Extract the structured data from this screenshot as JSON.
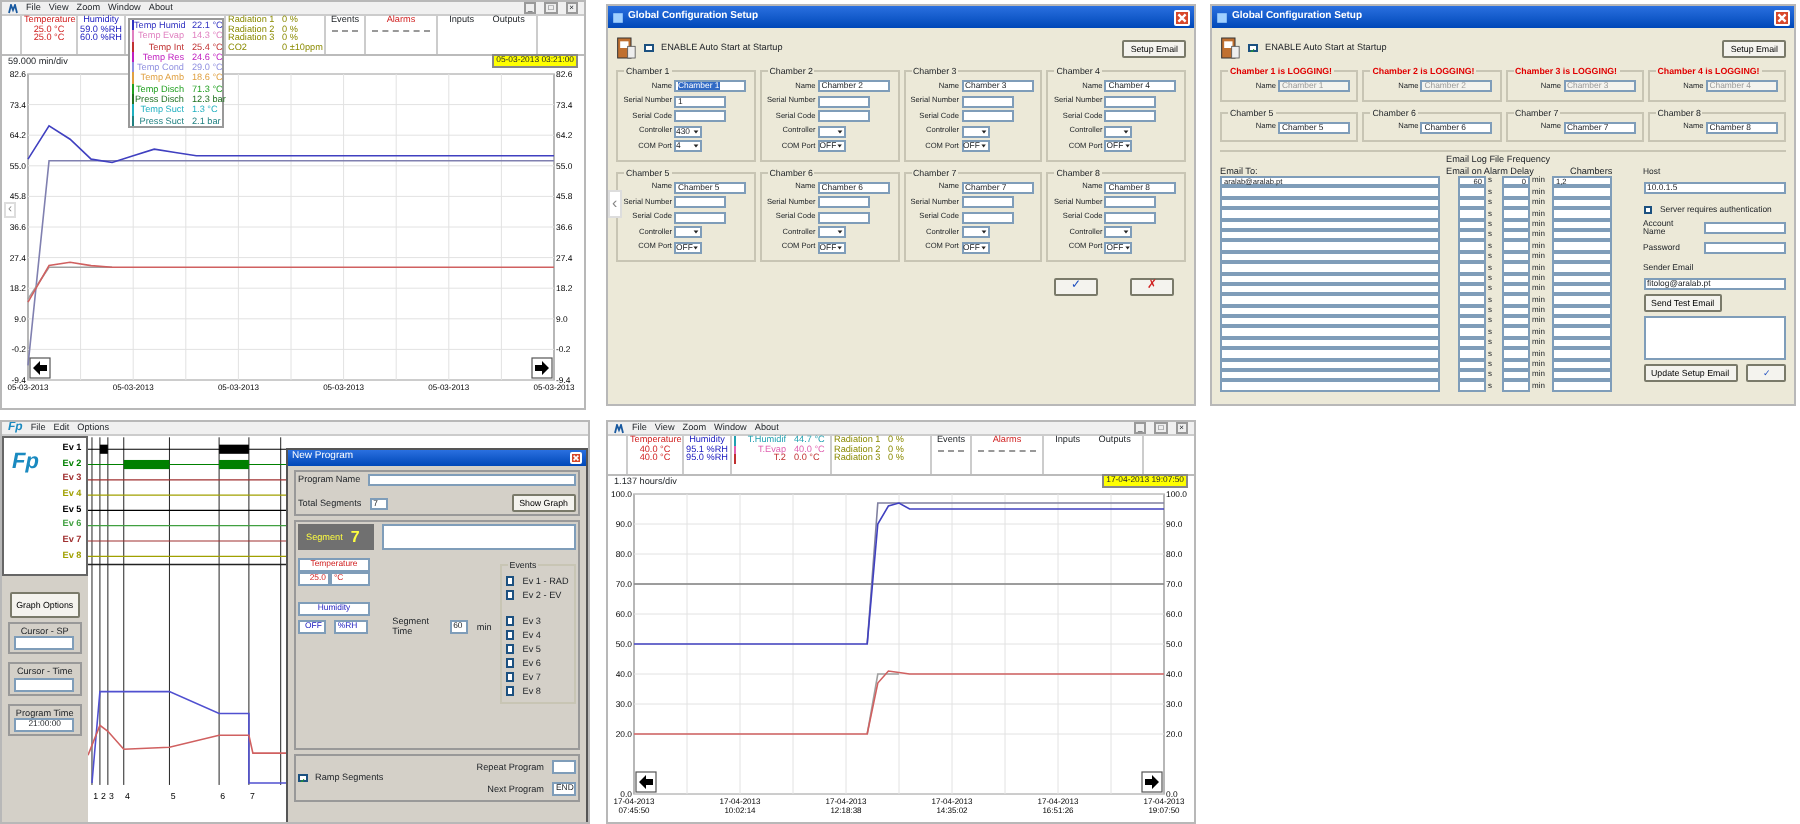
{
  "monitor_top": {
    "menu": [
      "File",
      "View",
      "Zoom",
      "Window",
      "About"
    ],
    "window_buttons": [
      "_",
      "□",
      "×"
    ],
    "temperature": {
      "label": "Temperature",
      "values": [
        "25.0 °C",
        "25.0 °C"
      ]
    },
    "humidity": {
      "label": "Humidity",
      "values": [
        "59.0 %RH",
        "60.0 %RH"
      ]
    },
    "sensors": [
      {
        "label": "Temp Humid",
        "value": "22.1 °C",
        "color": "#3030c0"
      },
      {
        "label": "Temp Evap",
        "value": "14.3 °C",
        "color": "#e080c0"
      },
      {
        "label": "Temp Int",
        "value": "25.4 °C",
        "color": "#c03030"
      },
      {
        "label": "Temp Res",
        "value": "24.6 °C",
        "color": "#c020c0"
      },
      {
        "label": "Temp Cond",
        "value": "29.0 °C",
        "color": "#9090e0"
      },
      {
        "label": "Temp Amb",
        "value": "18.6 °C",
        "color": "#e0a040"
      },
      {
        "label": "Temp Disch",
        "value": "71.3 °C",
        "color": "#20a020"
      },
      {
        "label": "Press Disch",
        "value": "12.3 bar",
        "color": "#207020"
      },
      {
        "label": "Temp Suct",
        "value": "1.3 °C",
        "color": "#20b0c0"
      },
      {
        "label": "Press Suct",
        "value": "2.1 bar",
        "color": "#208080"
      }
    ],
    "radiation": [
      {
        "label": "Radiation 1",
        "value": "0 %"
      },
      {
        "label": "Radiation 2",
        "value": "0 %"
      },
      {
        "label": "Radiation 3",
        "value": "0 %"
      },
      {
        "label": "CO2",
        "value": "0 ±10ppm"
      }
    ],
    "events_label": "Events",
    "alarms_label": "Alarms",
    "inputs_label": "Inputs",
    "outputs_label": "Outputs",
    "scale": "59.000 min/div",
    "timestamp": "05-03-2013 03:21:00",
    "prev_arrow": "‹",
    "chart_data": {
      "type": "line",
      "grid": true,
      "ylim": [
        -9.4,
        82.6
      ],
      "categories": [
        "05-03-2013",
        null,
        null,
        null,
        null,
        "05-03-2013",
        null,
        null,
        null,
        null,
        "05-03-2013",
        null,
        null,
        null,
        null,
        "05-03-2013",
        null,
        null,
        null,
        null,
        "05-03-2013",
        null,
        null,
        null,
        null,
        "05-03-2013"
      ],
      "yticks": [
        {
          "value": 82.6,
          "label": "82.6"
        },
        {
          "value": 73.4,
          "label": "73.4"
        },
        {
          "value": 64.2,
          "label": "64.2"
        },
        {
          "value": 55,
          "label": "55.0"
        },
        {
          "value": 45.8,
          "label": "45.8"
        },
        {
          "value": 36.6,
          "label": "36.6"
        },
        {
          "value": 27.4,
          "label": "27.4"
        },
        {
          "value": 18.2,
          "label": "18.2"
        },
        {
          "value": 9,
          "label": "9.0"
        },
        {
          "value": -0.2,
          "label": "-0.2"
        },
        {
          "value": -9.4,
          "label": "-9.4"
        }
      ],
      "series": [
        {
          "color": "#8080b0",
          "values": [
            -5,
            56.5,
            56.5,
            56.5,
            56.5,
            56.5,
            56.5,
            56.5,
            56.5,
            56.5,
            56.5,
            56.5,
            56.5,
            56.5,
            56.5,
            56.5,
            56.5,
            56.5,
            56.5,
            56.5,
            56.5,
            56.5,
            56.5,
            56.5,
            56.5,
            56.5
          ]
        },
        {
          "color": "#4040c0",
          "values": [
            57,
            67,
            63,
            57,
            56,
            58,
            60,
            59,
            58,
            58,
            58,
            58,
            58,
            58,
            58,
            58,
            58,
            58,
            58,
            58,
            58,
            58,
            58,
            58,
            58,
            58
          ]
        },
        {
          "color": "#a0a0a0",
          "values": [
            15,
            24.5,
            24.5,
            24.5,
            24.5,
            null,
            null,
            null,
            null,
            null,
            null,
            null,
            null,
            null,
            null,
            null,
            null,
            null,
            null,
            null,
            null,
            null,
            null,
            null,
            null,
            null
          ]
        },
        {
          "color": "#d06060",
          "values": [
            14,
            25,
            26,
            25,
            24.5,
            24.5,
            24.5,
            24.5,
            24.5,
            24.5,
            24.5,
            24.5,
            24.5,
            24.5,
            24.5,
            24.5,
            24.5,
            24.5,
            24.5,
            24.5,
            24.5,
            24.5,
            24.5,
            24.5,
            24.5,
            24.5
          ]
        }
      ]
    },
    "right_axis_labels": [
      "82.6",
      "73.4",
      "64.2",
      "55.0",
      "45.8",
      "36.6",
      "27.4",
      "18.2",
      "9.0",
      "-0.2",
      "-9.4"
    ]
  },
  "config_top": {
    "title": "Global Configuration Setup",
    "prev_arrow": "‹",
    "auto_start": {
      "label": "ENABLE Auto Start at Startup",
      "checked": false
    },
    "setup_email": "Setup Email",
    "chambers": [
      {
        "legend": "Chamber 1",
        "logging": false,
        "fields": [
          {
            "label": "Name",
            "value": "Chamber 1",
            "kind": "text",
            "text_selected": true
          },
          {
            "label": "Serial Number",
            "value": "1",
            "kind": "text"
          },
          {
            "label": "Serial Code",
            "kind": "text"
          },
          {
            "label": "Controller",
            "value": "430",
            "kind": "select"
          },
          {
            "label": "COM Port",
            "value": "4",
            "kind": "select"
          }
        ]
      },
      {
        "legend": "Chamber 2",
        "logging": false,
        "fields": [
          {
            "label": "Name",
            "value": "Chamber 2",
            "kind": "text",
            "text_selected": false
          },
          {
            "label": "Serial Number",
            "kind": "text"
          },
          {
            "label": "Serial Code",
            "kind": "text"
          },
          {
            "label": "Controller",
            "kind": "select"
          },
          {
            "label": "COM Port",
            "value": "OFF",
            "kind": "select"
          }
        ]
      },
      {
        "legend": "Chamber 3",
        "logging": false,
        "fields": [
          {
            "label": "Name",
            "value": "Chamber 3",
            "kind": "text",
            "text_selected": false
          },
          {
            "label": "Serial Number",
            "kind": "text"
          },
          {
            "label": "Serial Code",
            "kind": "text"
          },
          {
            "label": "Controller",
            "kind": "select"
          },
          {
            "label": "COM Port",
            "value": "OFF",
            "kind": "select"
          }
        ]
      },
      {
        "legend": "Chamber 4",
        "logging": false,
        "fields": [
          {
            "label": "Name",
            "value": "Chamber 4",
            "kind": "text",
            "text_selected": false
          },
          {
            "label": "Serial Number",
            "kind": "text"
          },
          {
            "label": "Serial Code",
            "kind": "text"
          },
          {
            "label": "Controller",
            "kind": "select"
          },
          {
            "label": "COM Port",
            "value": "OFF",
            "kind": "select"
          }
        ]
      },
      {
        "legend": "Chamber 5",
        "logging": false,
        "fields": [
          {
            "label": "Name",
            "value": "Chamber 5",
            "kind": "text",
            "text_selected": false
          },
          {
            "label": "Serial Number",
            "kind": "text"
          },
          {
            "label": "Serial Code",
            "kind": "text"
          },
          {
            "label": "Controller",
            "kind": "select"
          },
          {
            "label": "COM Port",
            "value": "OFF",
            "kind": "select"
          }
        ]
      },
      {
        "legend": "Chamber 6",
        "logging": false,
        "fields": [
          {
            "label": "Name",
            "value": "Chamber 6",
            "kind": "text",
            "text_selected": false
          },
          {
            "label": "Serial Number",
            "kind": "text"
          },
          {
            "label": "Serial Code",
            "kind": "text"
          },
          {
            "label": "Controller",
            "kind": "select"
          },
          {
            "label": "COM Port",
            "value": "OFF",
            "kind": "select"
          }
        ]
      },
      {
        "legend": "Chamber 7",
        "logging": false,
        "fields": [
          {
            "label": "Name",
            "value": "Chamber 7",
            "kind": "text",
            "text_selected": false
          },
          {
            "label": "Serial Number",
            "kind": "text"
          },
          {
            "label": "Serial Code",
            "kind": "text"
          },
          {
            "label": "Controller",
            "kind": "select"
          },
          {
            "label": "COM Port",
            "value": "OFF",
            "kind": "select"
          }
        ]
      },
      {
        "legend": "Chamber 8",
        "logging": false,
        "fields": [
          {
            "label": "Name",
            "value": "Chamber 8",
            "kind": "text",
            "text_selected": false
          },
          {
            "label": "Serial Number",
            "kind": "text"
          },
          {
            "label": "Serial Code",
            "kind": "text"
          },
          {
            "label": "Controller",
            "kind": "select"
          },
          {
            "label": "COM Port",
            "value": "OFF",
            "kind": "select"
          }
        ]
      }
    ],
    "ok": "✓",
    "cancel": "✗"
  },
  "config_logging": {
    "title": "Global Configuration Setup",
    "auto_start": {
      "label": "ENABLE Auto Start at Startup",
      "checked": true
    },
    "setup_email": "Setup Email",
    "chambers": [
      {
        "legend": "Chamber 1 is LOGGING!",
        "logging": true,
        "fields": [
          {
            "label": "Name",
            "value": "Chamber 1",
            "kind": "text"
          }
        ]
      },
      {
        "legend": "Chamber 2 is LOGGING!",
        "logging": true,
        "fields": [
          {
            "label": "Name",
            "value": "Chamber 2",
            "kind": "text"
          }
        ]
      },
      {
        "legend": "Chamber 3 is LOGGING!",
        "logging": true,
        "fields": [
          {
            "label": "Name",
            "value": "Chamber 3",
            "kind": "text"
          }
        ]
      },
      {
        "legend": "Chamber 4 is LOGGING!",
        "logging": true,
        "fields": [
          {
            "label": "Name",
            "value": "Chamber 4",
            "kind": "text"
          }
        ]
      },
      {
        "legend": "Chamber 5",
        "logging": false,
        "fields": [
          {
            "label": "Name",
            "value": "Chamber 5",
            "kind": "text"
          }
        ]
      },
      {
        "legend": "Chamber 6",
        "logging": false,
        "fields": [
          {
            "label": "Name",
            "value": "Chamber 6",
            "kind": "text"
          }
        ]
      },
      {
        "legend": "Chamber 7",
        "logging": false,
        "fields": [
          {
            "label": "Name",
            "value": "Chamber 7",
            "kind": "text"
          }
        ]
      },
      {
        "legend": "Chamber 8",
        "logging": false,
        "fields": [
          {
            "label": "Name",
            "value": "Chamber 8",
            "kind": "text"
          }
        ]
      }
    ],
    "email_to_label": "Email To:",
    "frequency_label": "Email Log File Frequency",
    "delay_label": "Email on Alarm Delay",
    "chambers_label": "Chambers",
    "email_rows": [
      {
        "email": "aralab@aralab.pt",
        "frequency": "60",
        "frequency_unit": "s",
        "delay": "0",
        "delay_unit": "min",
        "chambers": "1,2"
      },
      {
        "frequency_unit": "s",
        "delay_unit": "min"
      },
      {
        "frequency_unit": "s",
        "delay_unit": "min"
      },
      {
        "frequency_unit": "s",
        "delay_unit": "min"
      },
      {
        "frequency_unit": "s",
        "delay_unit": "min"
      },
      {
        "frequency_unit": "s",
        "delay_unit": "min"
      },
      {
        "frequency_unit": "s",
        "delay_unit": "min"
      },
      {
        "frequency_unit": "s",
        "delay_unit": "min"
      },
      {
        "frequency_unit": "s",
        "delay_unit": "min"
      },
      {
        "frequency_unit": "s",
        "delay_unit": "min"
      },
      {
        "frequency_unit": "s",
        "delay_unit": "min"
      },
      {
        "frequency_unit": "s",
        "delay_unit": "min"
      },
      {
        "frequency_unit": "s",
        "delay_unit": "min"
      },
      {
        "frequency_unit": "s",
        "delay_unit": "min"
      },
      {
        "frequency_unit": "s",
        "delay_unit": "min"
      },
      {
        "frequency_unit": "s",
        "delay_unit": "min"
      },
      {
        "frequency_unit": "s",
        "delay_unit": "min"
      },
      {
        "frequency_unit": "s",
        "delay_unit": "min"
      },
      {
        "frequency_unit": "s",
        "delay_unit": "min"
      },
      {
        "frequency_unit": "s",
        "delay_unit": "min"
      }
    ],
    "host_label": "Host",
    "host": "10.0.1.5",
    "auth": {
      "label": "Server requires authentication",
      "checked": false
    },
    "account_label": "Account Name",
    "password_label": "Password",
    "sender_label": "Sender Email",
    "sender": "fitolog@aralab.pt",
    "send_test": "Send Test Email",
    "update": "Update Setup Email",
    "ok": "✓"
  },
  "program_editor": {
    "logo": "Fp",
    "logo_large": "Fp",
    "menu": [
      "File",
      "Edit",
      "Options"
    ],
    "events": [
      {
        "label": "Ev 1",
        "color": "#000000"
      },
      {
        "label": "Ev 2",
        "color": "#008000"
      },
      {
        "label": "Ev 3",
        "color": "#a03030"
      },
      {
        "label": "Ev 4",
        "color": "#a0a000"
      },
      {
        "label": "Ev 5",
        "color": "#000000"
      },
      {
        "label": "Ev 6",
        "color": "#40a040"
      },
      {
        "label": "Ev 7",
        "color": "#a03030"
      },
      {
        "label": "Ev 8",
        "color": "#a0a000"
      }
    ],
    "segment_labels": [
      "1",
      "2",
      "3",
      "4",
      "5",
      "6",
      "7"
    ],
    "graph_options": "Graph Options",
    "cursor_sp_label": "Cursor - SP",
    "cursor_time_label": "Cursor - Time",
    "program_time_label": "Program Time",
    "program_time": "21:00:00",
    "dialog": {
      "title": "New Program",
      "program_name_label": "Program Name",
      "total_segments_label": "Total Segments",
      "total_segments": "7",
      "show_graph": "Show Graph",
      "segment_label": "Segment",
      "segment": "7",
      "temperature_label": "Temperature",
      "temperature": "25.0",
      "temperature_unit": "°C",
      "humidity_label": "Humidity",
      "humidity": "OFF",
      "humidity_unit": "%RH",
      "segment_time_label": "Segment Time",
      "segment_time": "60",
      "segment_time_unit": "min",
      "events_label": "Events",
      "events": [
        {
          "label": "Ev 1 - RAD",
          "checked": false
        },
        {
          "label": "Ev 2 - EV",
          "checked": false
        },
        {
          "label": "Ev 3",
          "checked": false
        },
        {
          "label": "Ev 4",
          "checked": false
        },
        {
          "label": "Ev 5",
          "checked": false
        },
        {
          "label": "Ev 6",
          "checked": false
        },
        {
          "label": "Ev 7",
          "checked": false
        },
        {
          "label": "Ev 8",
          "checked": false
        }
      ],
      "ramp": {
        "label": "Ramp Segments",
        "checked": true
      },
      "repeat_label": "Repeat Program",
      "next_label": "Next Program",
      "next": "END"
    }
  },
  "monitor_bottom": {
    "menu": [
      "File",
      "View",
      "Zoom",
      "Window",
      "About"
    ],
    "window_buttons": [
      "_",
      "□",
      "×"
    ],
    "temperature": {
      "label": "Temperature",
      "values": [
        "40.0 °C",
        "40.0 °C"
      ]
    },
    "humidity": {
      "label": "Humidity",
      "values": [
        "95.1 %RH",
        "95.0 %RH"
      ]
    },
    "sensors": [
      {
        "label": "T.Humidif",
        "value": "44.7 °C",
        "color": "#20a0b0"
      },
      {
        "label": "T.Evap",
        "value": "40.0 °C",
        "color": "#e060b0"
      },
      {
        "label": "T.2",
        "value": "0.0 °C",
        "color": "#c03030"
      }
    ],
    "radiation": [
      {
        "label": "Radiation 1",
        "value": "0 %"
      },
      {
        "label": "Radiation 2",
        "value": "0 %"
      },
      {
        "label": "Radiation 3",
        "value": "0 %"
      }
    ],
    "events_label": "Events",
    "alarms_label": "Alarms",
    "inputs_label": "Inputs",
    "outputs_label": "Outputs",
    "scale": "1.137 hours/div",
    "timestamp": "17-04-2013 19:07:50",
    "chart_data": {
      "type": "line",
      "grid": true,
      "ylim": [
        0,
        100
      ],
      "categories": [
        "17-04-2013 07:45:50",
        null,
        null,
        null,
        null,
        null,
        null,
        null,
        null,
        null,
        "17-04-2013 10:02:14",
        null,
        null,
        null,
        null,
        null,
        null,
        null,
        null,
        null,
        "17-04-2013 12:18:38",
        null,
        null,
        null,
        null,
        null,
        null,
        null,
        null,
        null,
        "17-04-2013 14:35:02",
        null,
        null,
        null,
        null,
        null,
        null,
        null,
        null,
        null,
        "17-04-2013 16:51:26",
        null,
        null,
        null,
        null,
        null,
        null,
        null,
        null,
        null,
        "17-04-2013 19:07:50"
      ],
      "yticks": [
        {
          "value": 100,
          "label": "100.0"
        },
        {
          "value": 90,
          "label": "90.0"
        },
        {
          "value": 80,
          "label": "80.0"
        },
        {
          "value": 70,
          "label": "70.0"
        },
        {
          "value": 60,
          "label": "60.0"
        },
        {
          "value": 50,
          "label": "50.0"
        },
        {
          "value": 40,
          "label": "40.0"
        },
        {
          "value": 30,
          "label": "30.0"
        },
        {
          "value": 20,
          "label": "20.0"
        },
        {
          "value": 0,
          "label": "0.0"
        }
      ],
      "series": [
        {
          "color": "#808080",
          "values": [
            70,
            70,
            70,
            70,
            70,
            70,
            70,
            70,
            70,
            70,
            70,
            70,
            70,
            70,
            70,
            70,
            70,
            70,
            70,
            70,
            70,
            70,
            70,
            70,
            70,
            70,
            70,
            70,
            70,
            70,
            70,
            70,
            70,
            70,
            70,
            70,
            70,
            70,
            70,
            70,
            70,
            70,
            70,
            70,
            70,
            70,
            70,
            70,
            70,
            70,
            70
          ]
        },
        {
          "color": "#8080a0",
          "values": [
            null,
            null,
            null,
            null,
            null,
            null,
            null,
            null,
            null,
            null,
            null,
            null,
            null,
            null,
            null,
            null,
            null,
            null,
            null,
            null,
            null,
            null,
            50,
            97,
            97,
            97,
            97,
            97,
            97,
            97,
            97,
            97,
            97,
            97,
            97,
            97,
            97,
            97,
            97,
            97,
            97,
            97,
            97,
            97,
            97,
            97,
            97,
            97,
            97,
            97,
            97
          ]
        },
        {
          "color": "#4040c0",
          "values": [
            50,
            50,
            50,
            50,
            50,
            50,
            50,
            50,
            50,
            50,
            50,
            50,
            50,
            50,
            50,
            50,
            50,
            50,
            50,
            50,
            50,
            50,
            50,
            90,
            96,
            97,
            95,
            95,
            95,
            95,
            95,
            95,
            95,
            95,
            95,
            95,
            95,
            95,
            95,
            95,
            95,
            95,
            95,
            95,
            95,
            95,
            95,
            95,
            95,
            95,
            95
          ]
        },
        {
          "color": "#a0a0a0",
          "values": [
            null,
            null,
            null,
            null,
            null,
            null,
            null,
            null,
            null,
            null,
            null,
            null,
            null,
            null,
            null,
            null,
            null,
            null,
            null,
            null,
            null,
            null,
            20,
            40,
            40,
            40,
            null,
            null,
            null,
            null,
            null,
            null,
            null,
            null,
            null,
            null,
            null,
            null,
            null,
            null,
            null,
            null,
            null,
            null,
            null,
            null,
            null,
            null,
            null,
            null,
            null
          ]
        },
        {
          "color": "#d06060",
          "values": [
            20,
            20,
            20,
            20,
            20,
            20,
            20,
            20,
            20,
            20,
            20,
            20,
            20,
            20,
            20,
            20,
            20,
            20,
            20,
            20,
            20,
            20,
            20,
            37,
            41,
            40.5,
            40,
            40,
            40,
            40,
            40,
            40,
            40,
            40,
            40,
            40,
            40,
            40,
            40,
            40,
            40,
            40,
            40,
            40,
            40,
            40,
            40,
            40,
            40,
            40,
            40
          ]
        }
      ]
    },
    "right_axis_labels": [
      "100.0",
      "90.0",
      "80.0",
      "70.0",
      "60.0",
      "50.0",
      "40.0",
      "30.0",
      "20.0",
      "0.0"
    ]
  }
}
